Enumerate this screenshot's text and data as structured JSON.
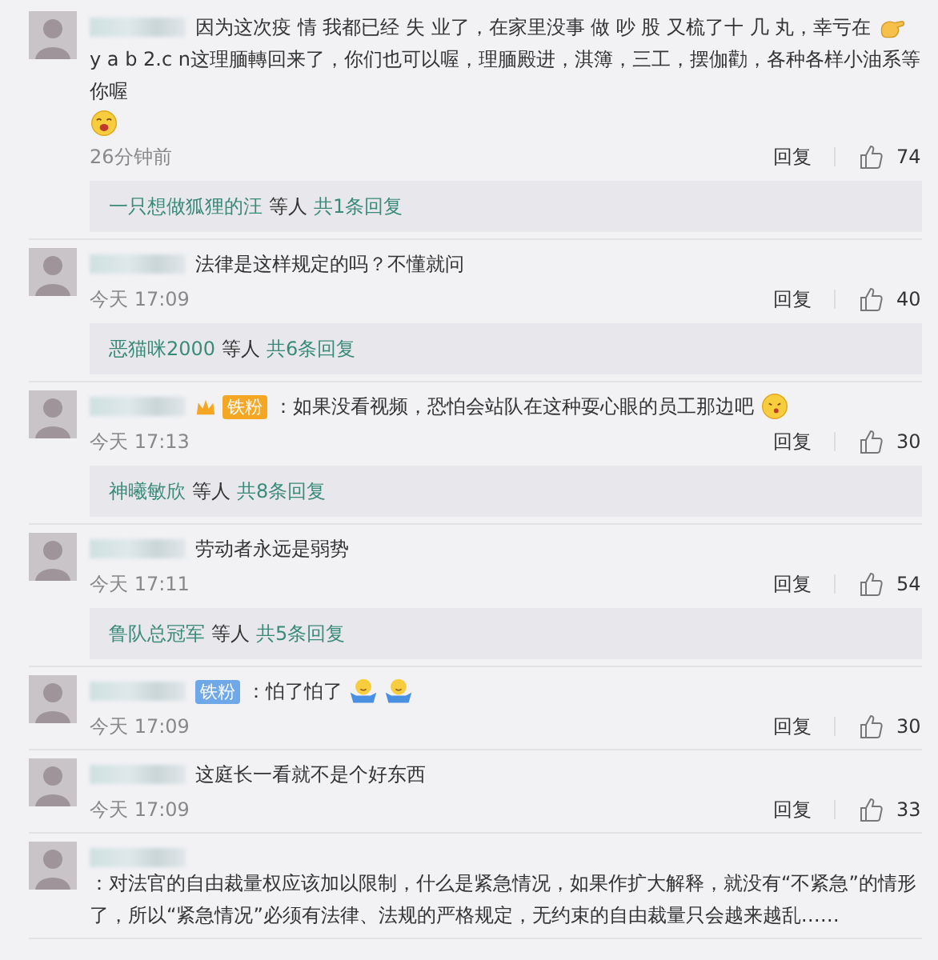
{
  "comments": [
    {
      "parts": [
        {
          "kind": "text",
          "text": "因为这次疫 情 我都已经 失 业了，在家里没事 做 吵 股 又梳了十 几 丸，幸亏在"
        },
        {
          "kind": "hand_emoji"
        },
        {
          "kind": "text",
          "text": "y a b 2.c n这理腼轉回来了，你们也可以喔，理腼殿进，淇簿，三工，摆伽勸，各种各样小油系等你喔"
        },
        {
          "kind": "laugh_emoji"
        }
      ],
      "time": "26分钟前",
      "reply": "回复",
      "likes": "74",
      "thread": {
        "name": "一只想做狐狸的汪",
        "others": "等人",
        "count": "共1条回复"
      }
    },
    {
      "parts": [
        {
          "kind": "text",
          "text": "法律是这样规定的吗？不懂就问"
        }
      ],
      "time": "今天 17:09",
      "reply": "回复",
      "likes": "40",
      "thread": {
        "name": "恶猫咪2000",
        "others": "等人",
        "count": "共6条回复"
      }
    },
    {
      "badges": [
        {
          "kind": "crown",
          "label": "铁粉",
          "color": "#f5a623"
        }
      ],
      "parts": [
        {
          "kind": "text",
          "text": "：如果没看视频，恐怕会站队在这种耍心眼的员工那边吧"
        },
        {
          "kind": "shush_emoji"
        }
      ],
      "time": "今天 17:13",
      "reply": "回复",
      "likes": "30",
      "thread": {
        "name": "神曦敏欣",
        "others": "等人",
        "count": "共8条回复"
      }
    },
    {
      "parts": [
        {
          "kind": "text",
          "text": "劳动者永远是弱势"
        }
      ],
      "time": "今天 17:11",
      "reply": "回复",
      "likes": "54",
      "thread": {
        "name": "鲁队总冠军",
        "others": "等人",
        "count": "共5条回复"
      }
    },
    {
      "badges": [
        {
          "kind": "plain",
          "label": "铁粉",
          "color": "#6fa8e8"
        }
      ],
      "parts": [
        {
          "kind": "text",
          "text": "：怕了怕了"
        },
        {
          "kind": "shrug_emoji"
        },
        {
          "kind": "shrug_emoji"
        }
      ],
      "time": "今天 17:09",
      "reply": "回复",
      "likes": "30"
    },
    {
      "parts": [
        {
          "kind": "text",
          "text": "这庭长一看就不是个好东西"
        }
      ],
      "time": "今天 17:09",
      "reply": "回复",
      "likes": "33"
    },
    {
      "parts": [
        {
          "kind": "text",
          "text": "：对法官的自由裁量权应该加以限制，什么是紧急情况，如果作扩大解释，就没有“不紧急”的情形了，所以“紧急情况”必须有法律、法规的严格规定，无约束的自由裁量只会越来越乱……"
        }
      ]
    }
  ]
}
